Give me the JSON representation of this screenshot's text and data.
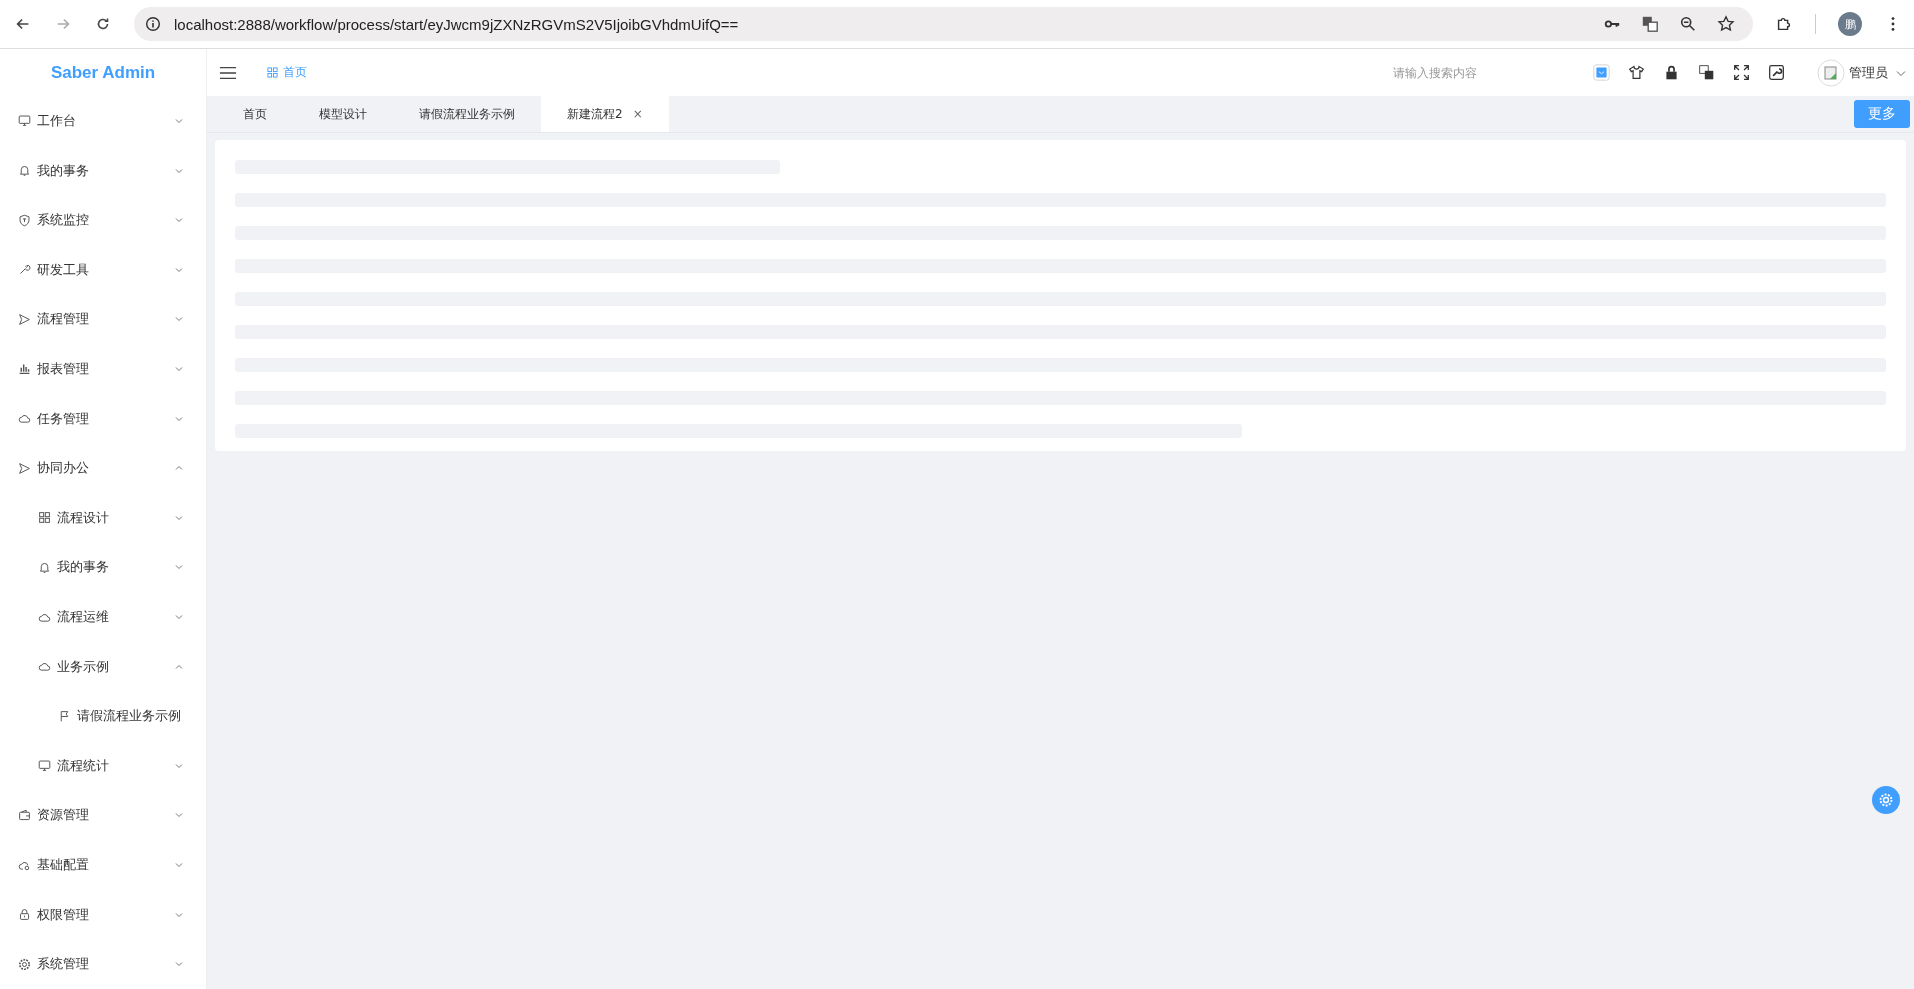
{
  "browser": {
    "url": "localhost:2888/workflow/process/start/eyJwcm9jZXNzRGVmS2V5IjoibGVhdmUifQ==",
    "profile": "鹏",
    "forward_disabled": true
  },
  "sidebar": {
    "logo": "Saber Admin",
    "items": [
      {
        "label": "工作台",
        "expanded": false
      },
      {
        "label": "我的事务",
        "expanded": false
      },
      {
        "label": "系统监控",
        "expanded": false
      },
      {
        "label": "研发工具",
        "expanded": false
      },
      {
        "label": "流程管理",
        "expanded": false
      },
      {
        "label": "报表管理",
        "expanded": false
      },
      {
        "label": "任务管理",
        "expanded": false
      },
      {
        "label": "协同办公",
        "expanded": true,
        "children": [
          {
            "label": "流程设计",
            "expanded": false
          },
          {
            "label": "我的事务",
            "expanded": false
          },
          {
            "label": "流程运维",
            "expanded": false
          },
          {
            "label": "业务示例",
            "expanded": true,
            "children": [
              {
                "label": "请假流程业务示例"
              }
            ]
          },
          {
            "label": "流程统计",
            "expanded": false
          }
        ]
      },
      {
        "label": "资源管理",
        "expanded": false
      },
      {
        "label": "基础配置",
        "expanded": false
      },
      {
        "label": "权限管理",
        "expanded": false
      },
      {
        "label": "系统管理",
        "expanded": false
      }
    ]
  },
  "header": {
    "breadcrumb": "首页",
    "search": {
      "placeholder": "请输入搜索内容"
    },
    "user": "管理员"
  },
  "tabs": [
    {
      "label": "首页",
      "selected": false
    },
    {
      "label": "模型设计",
      "selected": false
    },
    {
      "label": "请假流程业务示例",
      "selected": false
    },
    {
      "label": "新建流程2",
      "selected": true,
      "close": "×"
    }
  ],
  "more_button": "更多"
}
